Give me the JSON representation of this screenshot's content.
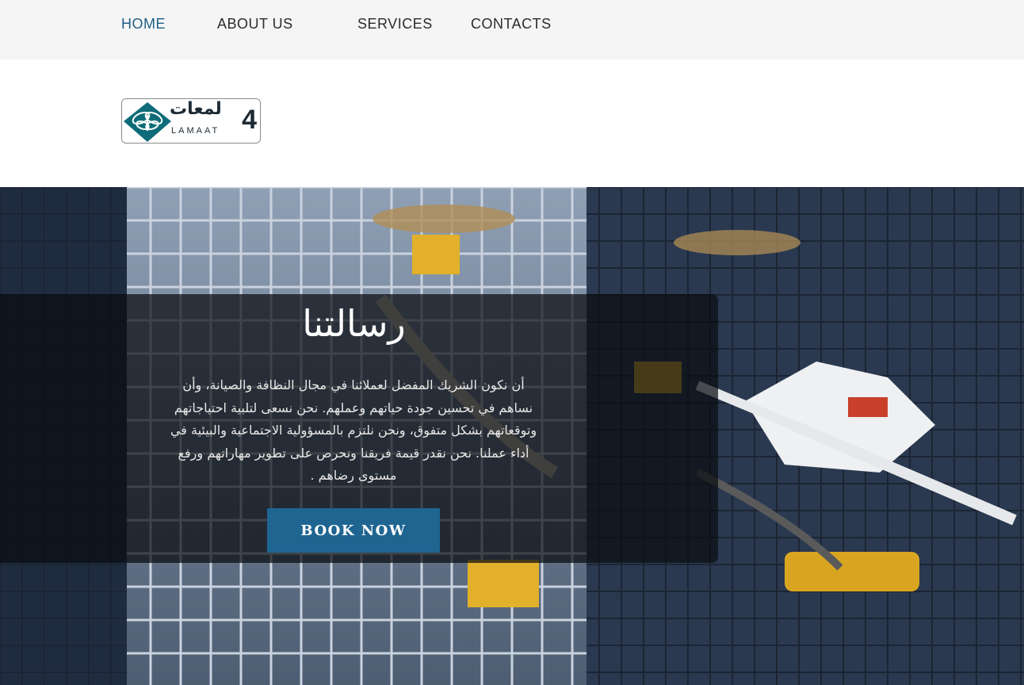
{
  "nav": {
    "items": [
      {
        "label": "HOME",
        "active": true
      },
      {
        "label": "ABOUT US",
        "active": false
      },
      {
        "label": "SERVICES",
        "active": false
      },
      {
        "label": "CONTACTS",
        "active": false
      }
    ]
  },
  "logo": {
    "arabic": "لمعات",
    "latin": "LAMAAT",
    "mark": "4",
    "icon": "butterfly-drone-logo-icon"
  },
  "hero": {
    "title": "رسالتنا",
    "text": "أن نكون الشريك المفضل لعملائنا في مجال النظافة والصيانة، وأن نساهم في تحسين جودة حياتهم وعملهم. نحن نسعى لتلبية احتياجاتهم وتوقعاتهم بشكل متفوق، ونحن نلتزم بالمسؤولية الاجتماعية والبيئية في أداء عملنا. نحن نقدر قيمة فريقنا ونحرص على تطوير مهاراتهم ورفع مستوى رضاهم .",
    "button_label": "BOOK NOW",
    "background_image": "drone-cleaning-skyscraper-image"
  },
  "colors": {
    "nav_bg": "#f5f5f5",
    "active_link": "#1f5f86",
    "button_bg": "#1f6592",
    "logo_teal": "#0e6b78"
  }
}
